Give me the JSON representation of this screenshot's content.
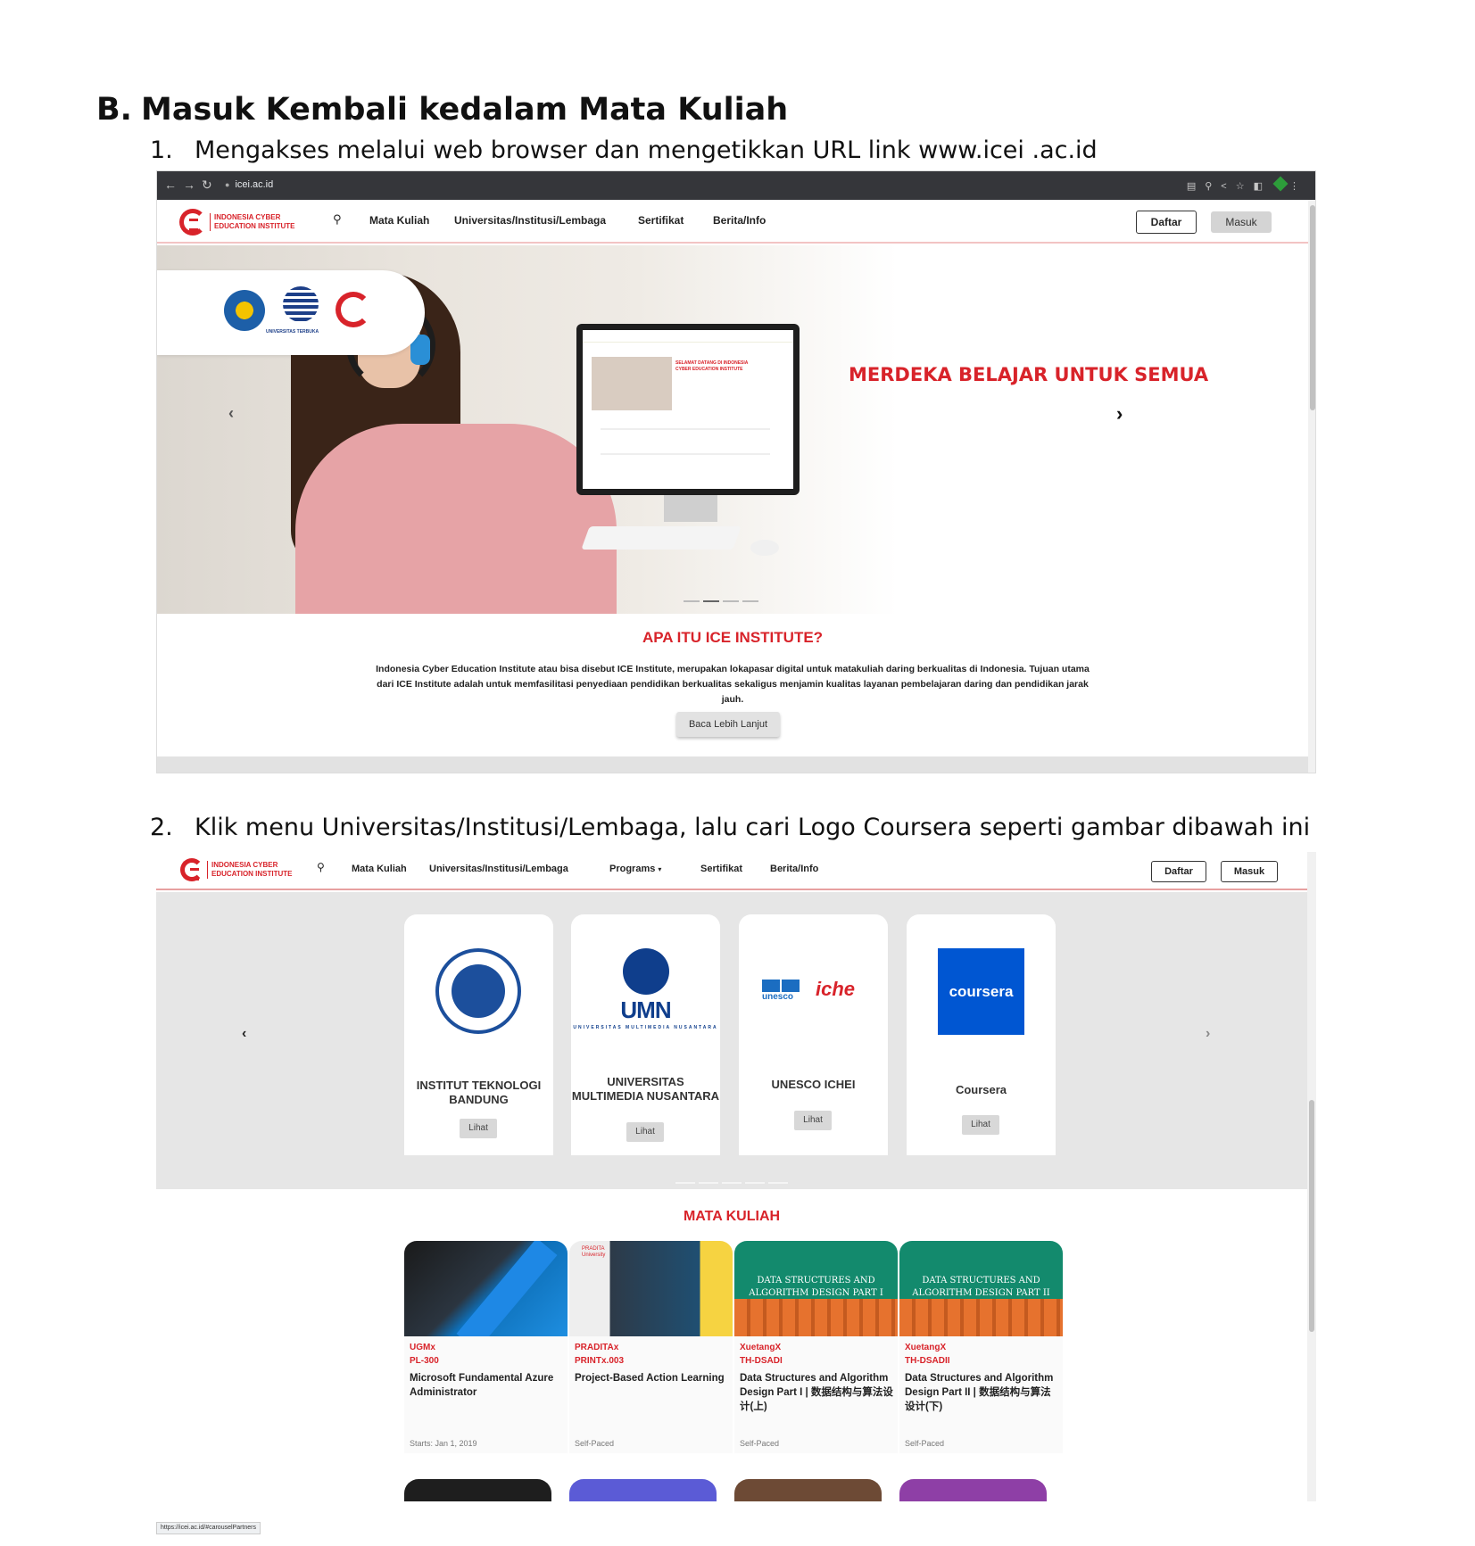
{
  "document": {
    "section_letter": "B.",
    "section_title": "Masuk Kembali kedalam Mata Kuliah",
    "step1_num": "1.",
    "step1_text": "Mengakses melalui web browser dan mengetikkan URL link www.icei .ac.id",
    "step2_num": "2.",
    "step2_text": "Klik menu Universitas/Institusi/Lembaga, lalu cari Logo Coursera seperti gambar dibawah ini"
  },
  "browser": {
    "url": "icei.ac.id",
    "status_url": "https://icei.ac.id/#carouselPartners"
  },
  "site": {
    "logo_line1": "INDONESIA CYBER",
    "logo_line2": "EDUCATION INSTITUTE",
    "nav": {
      "mata_kuliah": "Mata Kuliah",
      "universitas": "Universitas/Institusi/Lembaga",
      "programs": "Programs",
      "sertifikat": "Sertifikat",
      "berita": "Berita/Info",
      "daftar": "Daftar",
      "masuk": "Masuk"
    }
  },
  "hero": {
    "partner_caption": "UNIVERSITAS TERBUKA",
    "headline": "MERDEKA BELAJAR UNTUK SEMUA",
    "screen_title": "SELAMAT DATANG DI INDONESIA CYBER EDUCATION INSTITUTE"
  },
  "about": {
    "title": "APA ITU ICE INSTITUTE?",
    "text": "Indonesia Cyber Education Institute atau bisa disebut ICE Institute, merupakan lokapasar digital untuk matakuliah daring berkualitas di Indonesia. Tujuan utama dari ICE Institute adalah untuk memfasilitasi penyediaan pendidikan berkualitas sekaligus menjamin kualitas layanan pembelajaran daring dan pendidikan jarak jauh.",
    "button": "Baca Lebih Lanjut"
  },
  "partners": {
    "view_label": "Lihat",
    "items": [
      {
        "name": "INSTITUT TEKNOLOGI BANDUNG"
      },
      {
        "name": "UNIVERSITAS MULTIMEDIA NUSANTARA",
        "logo_text": "UMN",
        "logo_sub": "UNIVERSITAS MULTIMEDIA NUSANTARA"
      },
      {
        "name": "UNESCO ICHEI",
        "logo_text": "unesco",
        "logo_text2": "iche"
      },
      {
        "name": "Coursera",
        "logo_text": "coursera"
      }
    ]
  },
  "mata_kuliah": {
    "title": "MATA KULIAH",
    "courses": [
      {
        "org": "UGMx",
        "code": "PL-300",
        "title": "Microsoft Fundamental Azure Administrator",
        "meta": "Starts: Jan 1, 2019"
      },
      {
        "org": "PRADITAx",
        "code": "PRINTx.003",
        "title": "Project-Based Action Learning",
        "meta": "Self-Paced",
        "img_label": "PRADITA University"
      },
      {
        "org": "XuetangX",
        "code": "TH-DSADI",
        "title": "Data Structures and Algorithm Design Part I | 数据结构与算法设计(上)",
        "meta": "Self-Paced",
        "img_caption": "DATA STRUCTURES AND ALGORITHM DESIGN PART I"
      },
      {
        "org": "XuetangX",
        "code": "TH-DSADII",
        "title": "Data Structures and Algorithm Design Part II | 数据结构与算法设计(下)",
        "meta": "Self-Paced",
        "img_caption": "DATA STRUCTURES AND ALGORITHM DESIGN PART II"
      }
    ]
  },
  "colors": {
    "brand_red": "#d8232a",
    "coursera_blue": "#0056d2",
    "partners_bg": "#e6e6e6"
  },
  "icons": [
    "back-icon",
    "forward-icon",
    "reload-icon",
    "lock-icon",
    "search-icon",
    "chevron-left-icon",
    "chevron-right-icon",
    "caret-down-icon"
  ]
}
